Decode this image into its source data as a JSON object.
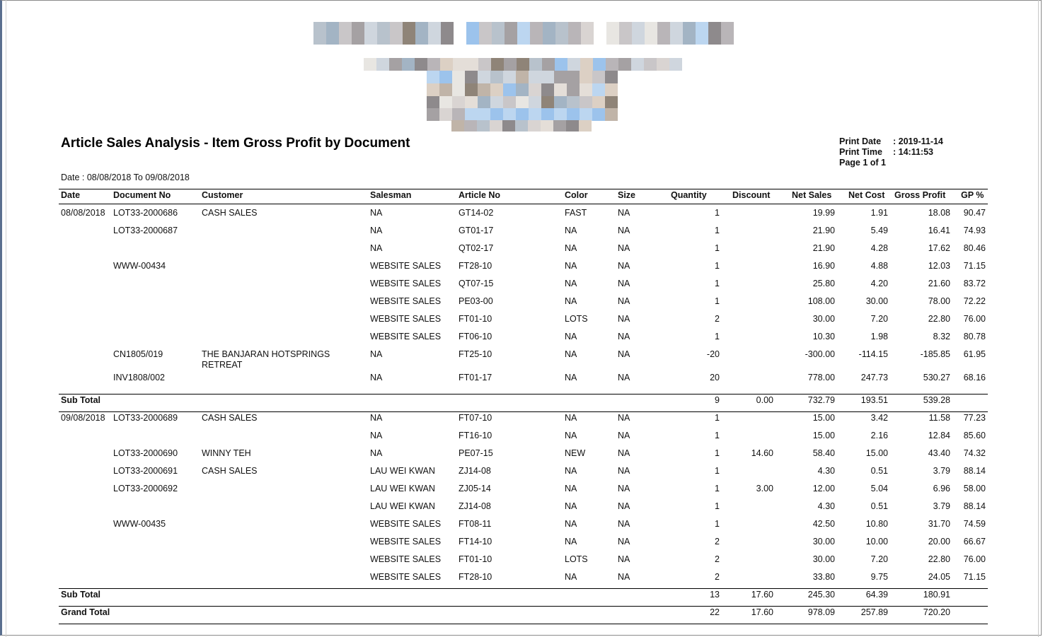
{
  "report": {
    "title": "Article Sales Analysis - Item Gross Profit by Document",
    "date_range": "Date : 08/08/2018 To 09/08/2018",
    "print_date_label": "Print Date",
    "print_date_value": ": 2019-11-14",
    "print_time_label": "Print Time",
    "print_time_value": ": 14:11:53",
    "page_info": "Page 1 of 1"
  },
  "columns": [
    "Date",
    "Document No",
    "Customer",
    "Salesman",
    "Article No",
    "Color",
    "Size",
    "Quantity",
    "Discount",
    "Net Sales",
    "Net Cost",
    "Gross Profit",
    "GP %"
  ],
  "rows": [
    {
      "date": "08/08/2018",
      "doc": "LOT33-2000686",
      "customer": "CASH SALES",
      "salesman": "NA",
      "article": "GT14-02",
      "color": "FAST",
      "size": "NA",
      "qty": "1",
      "discount": "",
      "net_sales": "19.99",
      "net_cost": "1.91",
      "gross_profit": "18.08",
      "gp": "90.47"
    },
    {
      "date": "",
      "doc": "LOT33-2000687",
      "customer": "",
      "salesman": "NA",
      "article": "GT01-17",
      "color": "NA",
      "size": "NA",
      "qty": "1",
      "discount": "",
      "net_sales": "21.90",
      "net_cost": "5.49",
      "gross_profit": "16.41",
      "gp": "74.93"
    },
    {
      "date": "",
      "doc": "",
      "customer": "",
      "salesman": "NA",
      "article": "QT02-17",
      "color": "NA",
      "size": "NA",
      "qty": "1",
      "discount": "",
      "net_sales": "21.90",
      "net_cost": "4.28",
      "gross_profit": "17.62",
      "gp": "80.46"
    },
    {
      "date": "",
      "doc": "WWW-00434",
      "customer": "",
      "salesman": "WEBSITE SALES",
      "article": "FT28-10",
      "color": "NA",
      "size": "NA",
      "qty": "1",
      "discount": "",
      "net_sales": "16.90",
      "net_cost": "4.88",
      "gross_profit": "12.03",
      "gp": "71.15"
    },
    {
      "date": "",
      "doc": "",
      "customer": "",
      "salesman": "WEBSITE SALES",
      "article": "QT07-15",
      "color": "NA",
      "size": "NA",
      "qty": "1",
      "discount": "",
      "net_sales": "25.80",
      "net_cost": "4.20",
      "gross_profit": "21.60",
      "gp": "83.72"
    },
    {
      "date": "",
      "doc": "",
      "customer": "",
      "salesman": "WEBSITE SALES",
      "article": "PE03-00",
      "color": "NA",
      "size": "NA",
      "qty": "1",
      "discount": "",
      "net_sales": "108.00",
      "net_cost": "30.00",
      "gross_profit": "78.00",
      "gp": "72.22"
    },
    {
      "date": "",
      "doc": "",
      "customer": "",
      "salesman": "WEBSITE SALES",
      "article": "FT01-10",
      "color": "LOTS",
      "size": "NA",
      "qty": "2",
      "discount": "",
      "net_sales": "30.00",
      "net_cost": "7.20",
      "gross_profit": "22.80",
      "gp": "76.00"
    },
    {
      "date": "",
      "doc": "",
      "customer": "",
      "salesman": "WEBSITE SALES",
      "article": "FT06-10",
      "color": "NA",
      "size": "NA",
      "qty": "1",
      "discount": "",
      "net_sales": "10.30",
      "net_cost": "1.98",
      "gross_profit": "8.32",
      "gp": "80.78"
    },
    {
      "date": "",
      "doc": "CN1805/019",
      "customer": "THE BANJARAN HOTSPRINGS RETREAT",
      "salesman": "NA",
      "article": "FT25-10",
      "color": "NA",
      "size": "NA",
      "qty": "-20",
      "discount": "",
      "net_sales": "-300.00",
      "net_cost": "-114.15",
      "gross_profit": "-185.85",
      "gp": "61.95"
    },
    {
      "date": "",
      "doc": "INV1808/002",
      "customer": "",
      "salesman": "NA",
      "article": "FT01-17",
      "color": "NA",
      "size": "NA",
      "qty": "20",
      "discount": "",
      "net_sales": "778.00",
      "net_cost": "247.73",
      "gross_profit": "530.27",
      "gp": "68.16"
    },
    {
      "date": "09/08/2018",
      "doc": "LOT33-2000689",
      "customer": "CASH SALES",
      "salesman": "NA",
      "article": "FT07-10",
      "color": "NA",
      "size": "NA",
      "qty": "1",
      "discount": "",
      "net_sales": "15.00",
      "net_cost": "3.42",
      "gross_profit": "11.58",
      "gp": "77.23"
    },
    {
      "date": "",
      "doc": "",
      "customer": "",
      "salesman": "NA",
      "article": "FT16-10",
      "color": "NA",
      "size": "NA",
      "qty": "1",
      "discount": "",
      "net_sales": "15.00",
      "net_cost": "2.16",
      "gross_profit": "12.84",
      "gp": "85.60"
    },
    {
      "date": "",
      "doc": "LOT33-2000690",
      "customer": "WINNY TEH",
      "salesman": "NA",
      "article": "PE07-15",
      "color": "NEW",
      "size": "NA",
      "qty": "1",
      "discount": "14.60",
      "net_sales": "58.40",
      "net_cost": "15.00",
      "gross_profit": "43.40",
      "gp": "74.32"
    },
    {
      "date": "",
      "doc": "LOT33-2000691",
      "customer": "CASH SALES",
      "salesman": "LAU WEI KWAN",
      "article": "ZJ14-08",
      "color": "NA",
      "size": "NA",
      "qty": "1",
      "discount": "",
      "net_sales": "4.30",
      "net_cost": "0.51",
      "gross_profit": "3.79",
      "gp": "88.14"
    },
    {
      "date": "",
      "doc": "LOT33-2000692",
      "customer": "",
      "salesman": "LAU WEI KWAN",
      "article": "ZJ05-14",
      "color": "NA",
      "size": "NA",
      "qty": "1",
      "discount": "3.00",
      "net_sales": "12.00",
      "net_cost": "5.04",
      "gross_profit": "6.96",
      "gp": "58.00"
    },
    {
      "date": "",
      "doc": "",
      "customer": "",
      "salesman": "LAU WEI KWAN",
      "article": "ZJ14-08",
      "color": "NA",
      "size": "NA",
      "qty": "1",
      "discount": "",
      "net_sales": "4.30",
      "net_cost": "0.51",
      "gross_profit": "3.79",
      "gp": "88.14"
    },
    {
      "date": "",
      "doc": "WWW-00435",
      "customer": "",
      "salesman": "WEBSITE SALES",
      "article": "FT08-11",
      "color": "NA",
      "size": "NA",
      "qty": "1",
      "discount": "",
      "net_sales": "42.50",
      "net_cost": "10.80",
      "gross_profit": "31.70",
      "gp": "74.59"
    },
    {
      "date": "",
      "doc": "",
      "customer": "",
      "salesman": "WEBSITE SALES",
      "article": "FT14-10",
      "color": "NA",
      "size": "NA",
      "qty": "2",
      "discount": "",
      "net_sales": "30.00",
      "net_cost": "10.00",
      "gross_profit": "20.00",
      "gp": "66.67"
    },
    {
      "date": "",
      "doc": "",
      "customer": "",
      "salesman": "WEBSITE SALES",
      "article": "FT01-10",
      "color": "LOTS",
      "size": "NA",
      "qty": "2",
      "discount": "",
      "net_sales": "30.00",
      "net_cost": "7.20",
      "gross_profit": "22.80",
      "gp": "76.00"
    },
    {
      "date": "",
      "doc": "",
      "customer": "",
      "salesman": "WEBSITE SALES",
      "article": "FT28-10",
      "color": "NA",
      "size": "NA",
      "qty": "2",
      "discount": "",
      "net_sales": "33.80",
      "net_cost": "9.75",
      "gross_profit": "24.05",
      "gp": "71.15"
    }
  ],
  "totals": [
    {
      "label": "Sub Total",
      "qty": "9",
      "discount": "0.00",
      "net_sales": "732.79",
      "net_cost": "193.51",
      "gross_profit": "539.28"
    },
    {
      "label": "Sub Total",
      "qty": "13",
      "discount": "17.60",
      "net_sales": "245.30",
      "net_cost": "64.39",
      "gross_profit": "180.91"
    },
    {
      "label": "Grand Total",
      "qty": "22",
      "discount": "17.60",
      "net_sales": "978.09",
      "net_cost": "257.89",
      "gross_profit": "720.20"
    }
  ],
  "pixelated_header": {
    "palette": [
      "#d9d4d2",
      "#c9c6c8",
      "#b9b5b8",
      "#a5a1a3",
      "#8e8a8c",
      "#e4ded8",
      "#cfd6de",
      "#b8c2cc",
      "#a3b4c4",
      "#9cc3ec",
      "#bcd6f0",
      "#dcd0c4",
      "#c0b4a8",
      "#8f8478",
      "#e8e6e2"
    ]
  }
}
